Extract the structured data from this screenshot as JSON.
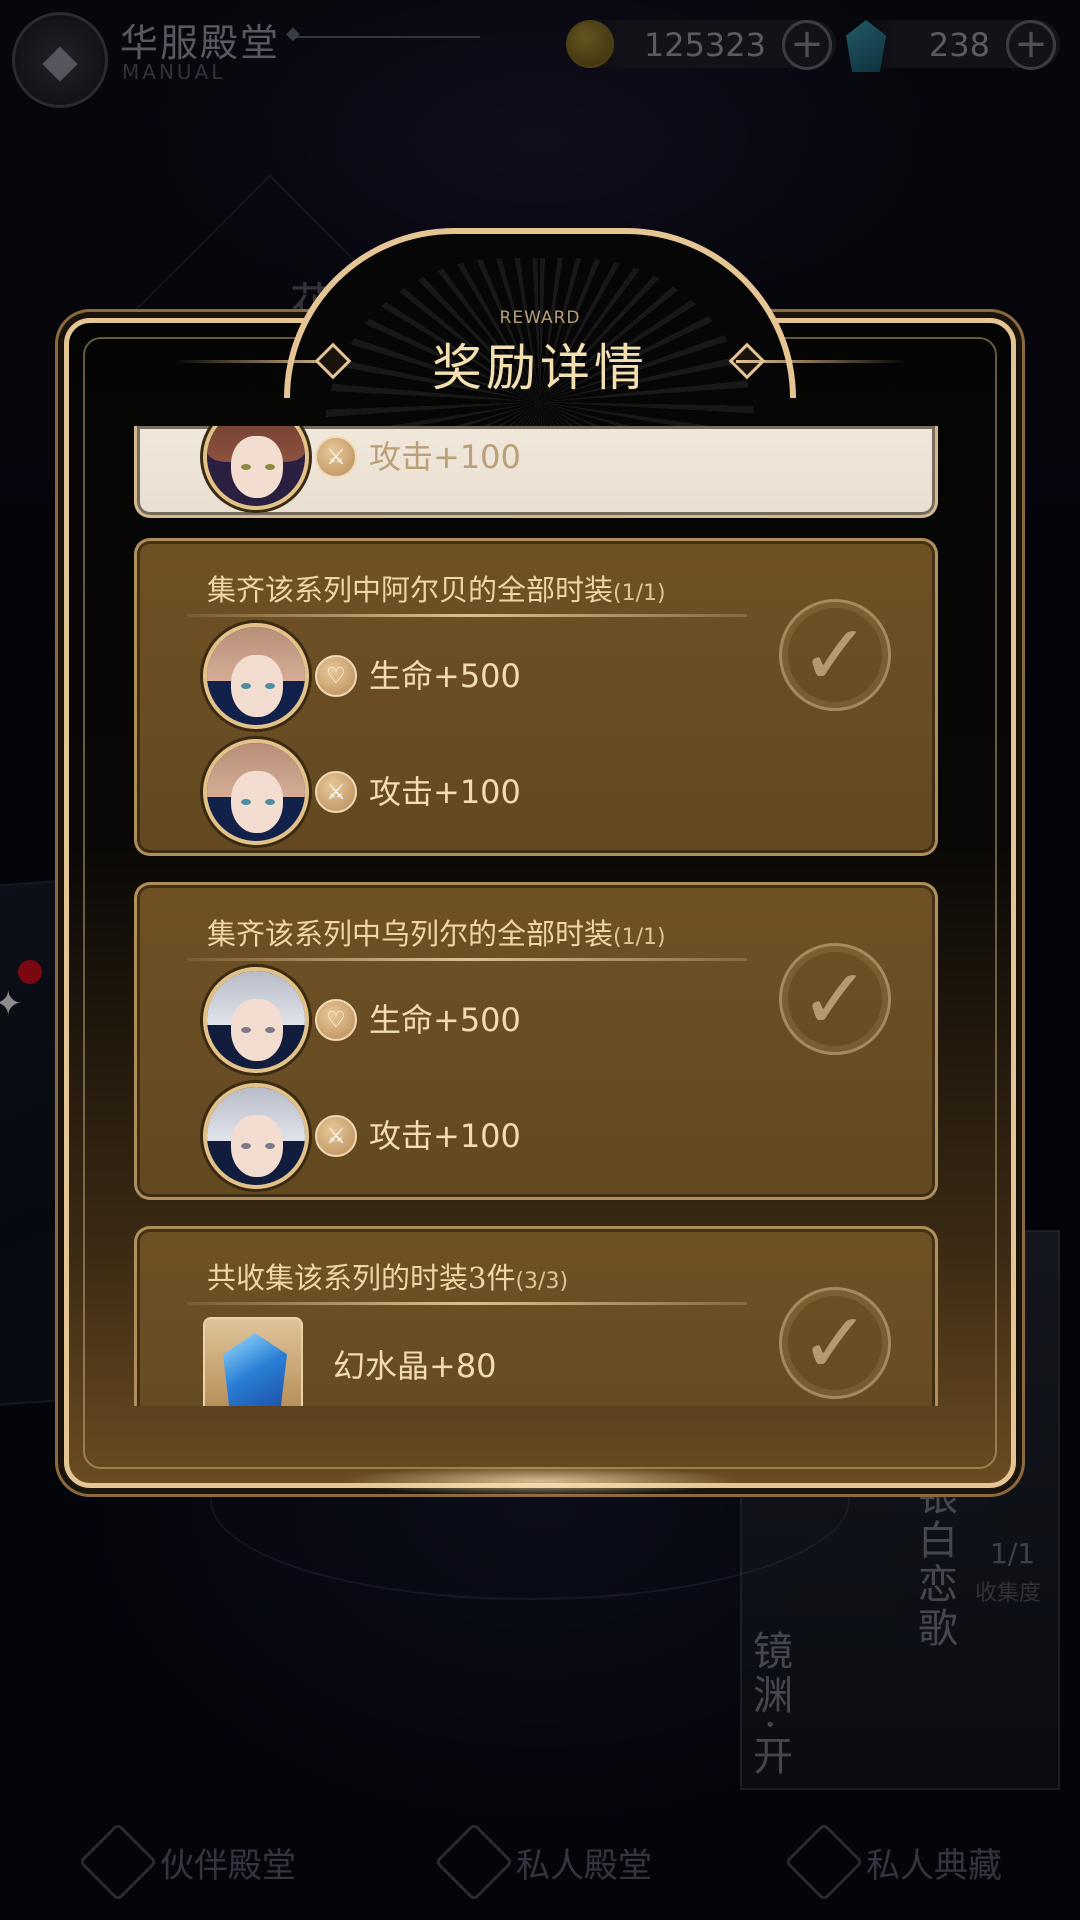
{
  "header": {
    "title": "华服殿堂",
    "subtitle": "MANUAL",
    "coins": "125323",
    "gems": "238"
  },
  "background": {
    "title": "花园的",
    "card_right_vertical_1": "银白恋歌",
    "card_right_vertical_2": "镜渊·开",
    "collection_count": "1/1",
    "collection_label": "收集度"
  },
  "modal": {
    "eyebrow": "REWARD",
    "title": "奖励详情",
    "cards": [
      {
        "rows": [
          {
            "stat": "攻击+100",
            "icon": "sword-icon"
          }
        ]
      },
      {
        "heading": "集齐该系列中阿尔贝的全部时装",
        "progress": "(1/1)",
        "rows": [
          {
            "stat": "生命+500",
            "icon": "heart-icon"
          },
          {
            "stat": "攻击+100",
            "icon": "sword-icon"
          }
        ],
        "completed": true
      },
      {
        "heading": "集齐该系列中乌列尔的全部时装",
        "progress": "(1/1)",
        "rows": [
          {
            "stat": "生命+500",
            "icon": "heart-icon"
          },
          {
            "stat": "攻击+100",
            "icon": "sword-icon"
          }
        ],
        "completed": true
      },
      {
        "heading": "共收集该系列的时装3件",
        "progress": "(3/3)",
        "rows": [
          {
            "stat": "幻水晶+80",
            "icon": "crystal-icon"
          }
        ],
        "completed": true
      }
    ]
  },
  "nav": {
    "items": [
      {
        "label": "伙伴殿堂"
      },
      {
        "label": "私人殿堂"
      },
      {
        "label": "私人典藏"
      }
    ]
  },
  "colors": {
    "gold_trim": "#e6c595",
    "card_fill": "#6f5125",
    "text_gold": "#f2dcb2"
  }
}
